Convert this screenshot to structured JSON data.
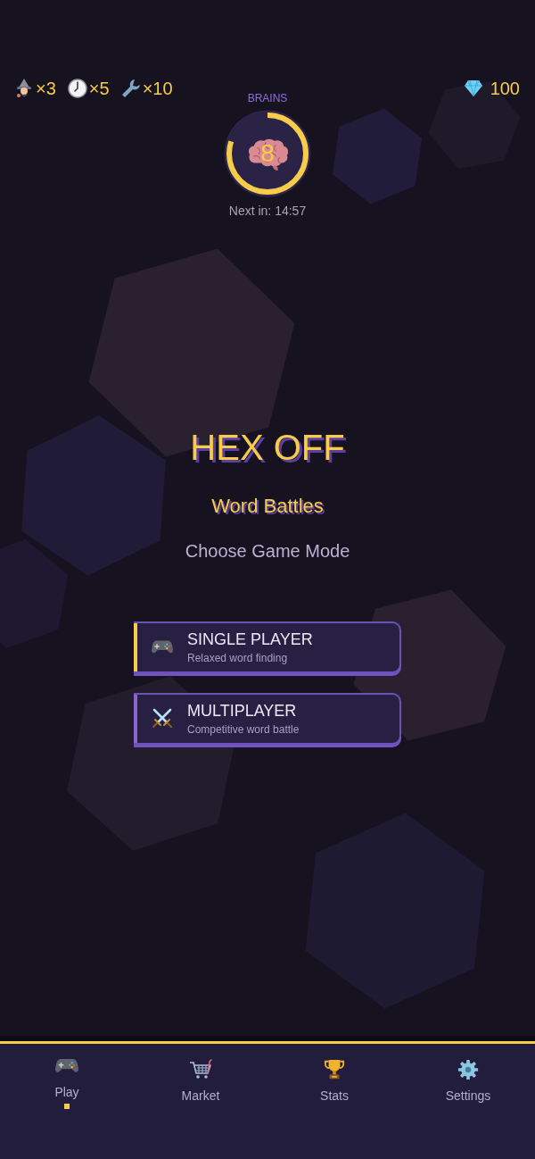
{
  "inventory": [
    {
      "kind": "wizard",
      "count": "×3"
    },
    {
      "kind": "clock",
      "count": "×5"
    },
    {
      "kind": "wrench",
      "count": "×10"
    }
  ],
  "gems": {
    "count": "100"
  },
  "brains": {
    "label": "BRAINS",
    "count": "8",
    "level": 0.8,
    "timer": "Next in: 14:57"
  },
  "title": "HEX OFF",
  "subtitle": "Word Battles",
  "prompt": "Choose Game Mode",
  "modes": [
    {
      "kind": "single",
      "title": "SINGLE PLAYER",
      "description": "Relaxed word finding",
      "selected": true
    },
    {
      "kind": "multi",
      "title": "MULTIPLAYER",
      "description": "Competitive word battle",
      "selected": false
    }
  ],
  "nav": [
    {
      "kind": "play",
      "label": "Play",
      "selected": true
    },
    {
      "kind": "market",
      "label": "Market",
      "selected": false
    },
    {
      "kind": "stats",
      "label": "Stats",
      "selected": false
    },
    {
      "kind": "settings",
      "label": "Settings",
      "selected": false
    }
  ]
}
